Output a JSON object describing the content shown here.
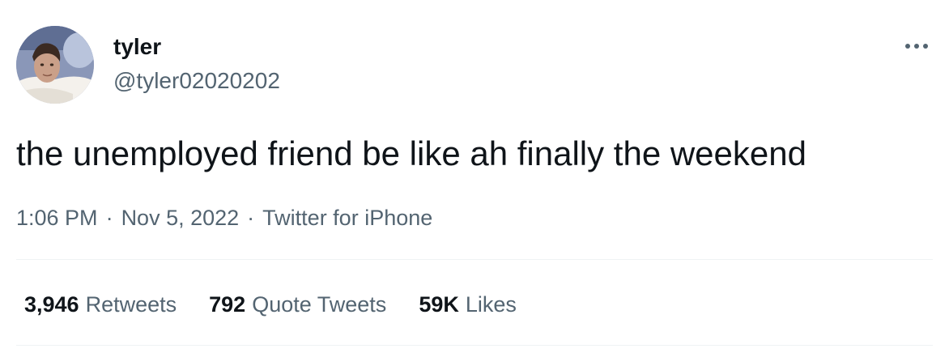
{
  "author": {
    "display_name": "tyler",
    "handle": "@tyler02020202",
    "avatar_icon": "profile-photo"
  },
  "more_icon": "ellipsis-icon",
  "tweet": {
    "text": "the unemployed friend be like ah finally the weekend",
    "time": "1:06 PM",
    "date": "Nov 5, 2022",
    "source": "Twitter for iPhone",
    "separator": "·"
  },
  "stats": {
    "retweets_count": "3,946",
    "retweets_label": "Retweets",
    "quotes_count": "792",
    "quotes_label": "Quote Tweets",
    "likes_count": "59K",
    "likes_label": "Likes"
  },
  "colors": {
    "primary_text": "#0f1419",
    "secondary_text": "#536471",
    "divider": "#eff3f4",
    "background": "#ffffff"
  }
}
